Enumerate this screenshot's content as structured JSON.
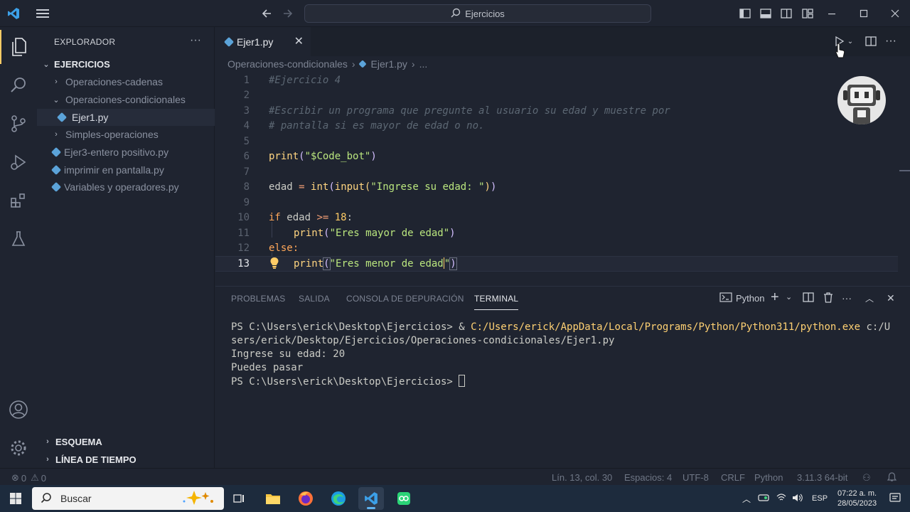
{
  "titlebar": {
    "search_text": "Ejercicios"
  },
  "sidebar": {
    "title": "EXPLORADOR",
    "root": "EJERCICIOS",
    "items": [
      {
        "label": "Operaciones-cadenas",
        "type": "folder",
        "expanded": false
      },
      {
        "label": "Operaciones-condicionales",
        "type": "folder",
        "expanded": true
      },
      {
        "label": "Ejer1.py",
        "type": "file",
        "selected": true
      },
      {
        "label": "Simples-operaciones",
        "type": "folder",
        "expanded": false
      },
      {
        "label": "Ejer3-entero positivo.py",
        "type": "file"
      },
      {
        "label": "imprimir en pantalla.py",
        "type": "file"
      },
      {
        "label": "Variables y operadores.py",
        "type": "file"
      }
    ],
    "sections": [
      "ESQUEMA",
      "LÍNEA DE TIEMPO"
    ]
  },
  "editor": {
    "tab_label": "Ejer1.py",
    "breadcrumb": [
      "Operaciones-condicionales",
      "Ejer1.py",
      "..."
    ],
    "current_line": 13,
    "line_numbers": [
      "1",
      "2",
      "3",
      "4",
      "5",
      "6",
      "7",
      "8",
      "9",
      "10",
      "11",
      "12",
      "13"
    ],
    "code": {
      "l1": "#Ejercicio 4",
      "l3": "#Escribir un programa que pregunte al usuario su edad y muestre por",
      "l4": "# pantalla si es mayor de edad o no.",
      "print": "print",
      "l6_str": "\"$Code_bot\"",
      "edad": "edad",
      "eq": "=",
      "int": "int",
      "input": "input",
      "l8_str": "\"Ingrese su edad: \"",
      "if": "if",
      "ge": ">=",
      "num": "18",
      "colon": ":",
      "l11_str": "\"Eres mayor de edad\"",
      "else": "else:",
      "l13_str_a": "\"Eres menor de edad",
      "l13_str_b": "\""
    }
  },
  "panel": {
    "tabs": [
      "PROBLEMAS",
      "SALIDA",
      "CONSOLA DE DEPURACIÓN",
      "TERMINAL"
    ],
    "active_tab": "TERMINAL",
    "shell_label": "Python",
    "terminal": {
      "l1_prompt": "PS C:\\Users\\erick\\Desktop\\Ejercicios> & ",
      "l1_path": "C:/Users/erick/AppData/Local/Programs/Python/Python311/python.exe",
      "l1_arg": " c:/U",
      "l2": "sers/erick/Desktop/Ejercicios/Operaciones-condicionales/Ejer1.py",
      "l3": "Ingrese su edad: 20",
      "l4": "Puedes pasar",
      "l5": "PS C:\\Users\\erick\\Desktop\\Ejercicios> "
    }
  },
  "statusbar": {
    "errors": "0",
    "warnings": "0",
    "position": "Lín. 13, col. 30",
    "spaces": "Espacios: 4",
    "encoding": "UTF-8",
    "eol": "CRLF",
    "language": "Python",
    "interpreter": "3.11.3 64-bit"
  },
  "taskbar": {
    "search_placeholder": "Buscar",
    "language": "ESP",
    "time": "07:22 a. m.",
    "date": "28/05/2023"
  },
  "colors": {
    "accent": "#ffcc66",
    "background": "#1f2430",
    "string": "#bae67e",
    "function": "#ffd580",
    "keyword": "#ffa759"
  }
}
